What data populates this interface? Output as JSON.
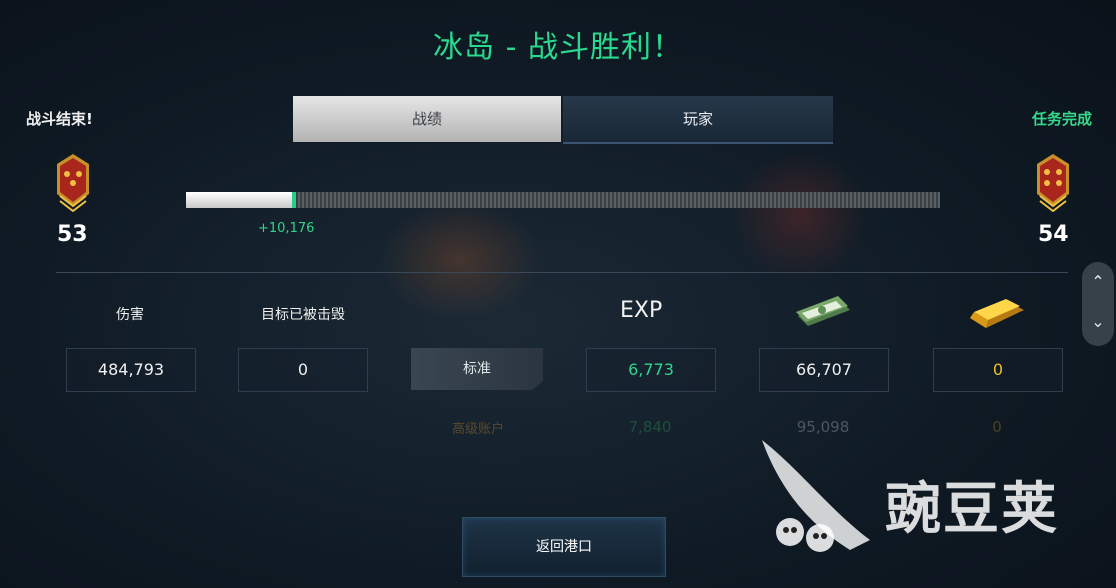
{
  "header": {
    "title": "冰岛 - 战斗胜利！"
  },
  "status": {
    "battle_over": "战斗结束!",
    "mission_complete": "任务完成"
  },
  "tabs": [
    {
      "label": "战绩",
      "active": true
    },
    {
      "label": "玩家",
      "active": false
    }
  ],
  "progress": {
    "level_current": "53",
    "level_next": "54",
    "fill_fraction": 0.14,
    "xp_gained": "+10,176"
  },
  "stats": {
    "damage_label": "伤害",
    "damage_value": "484,793",
    "destroyed_label": "目标已被击毁",
    "destroyed_value": "0"
  },
  "rewards": {
    "exp_header": "EXP",
    "cash_icon": "cash-icon",
    "gold_icon": "gold-bar-icon",
    "standard": {
      "label": "标准",
      "exp": "6,773",
      "cash": "66,707",
      "gold": "0"
    },
    "premium": {
      "label": "高级账户",
      "exp": "7,840",
      "cash": "95,098",
      "gold": "0"
    }
  },
  "colors": {
    "accent_green": "#28d98e",
    "gold": "#f0c020",
    "tab_active_bg": "#cfcfcf"
  },
  "buttons": {
    "return_label": "返回港口"
  },
  "watermark": {
    "text": "豌豆荚"
  }
}
